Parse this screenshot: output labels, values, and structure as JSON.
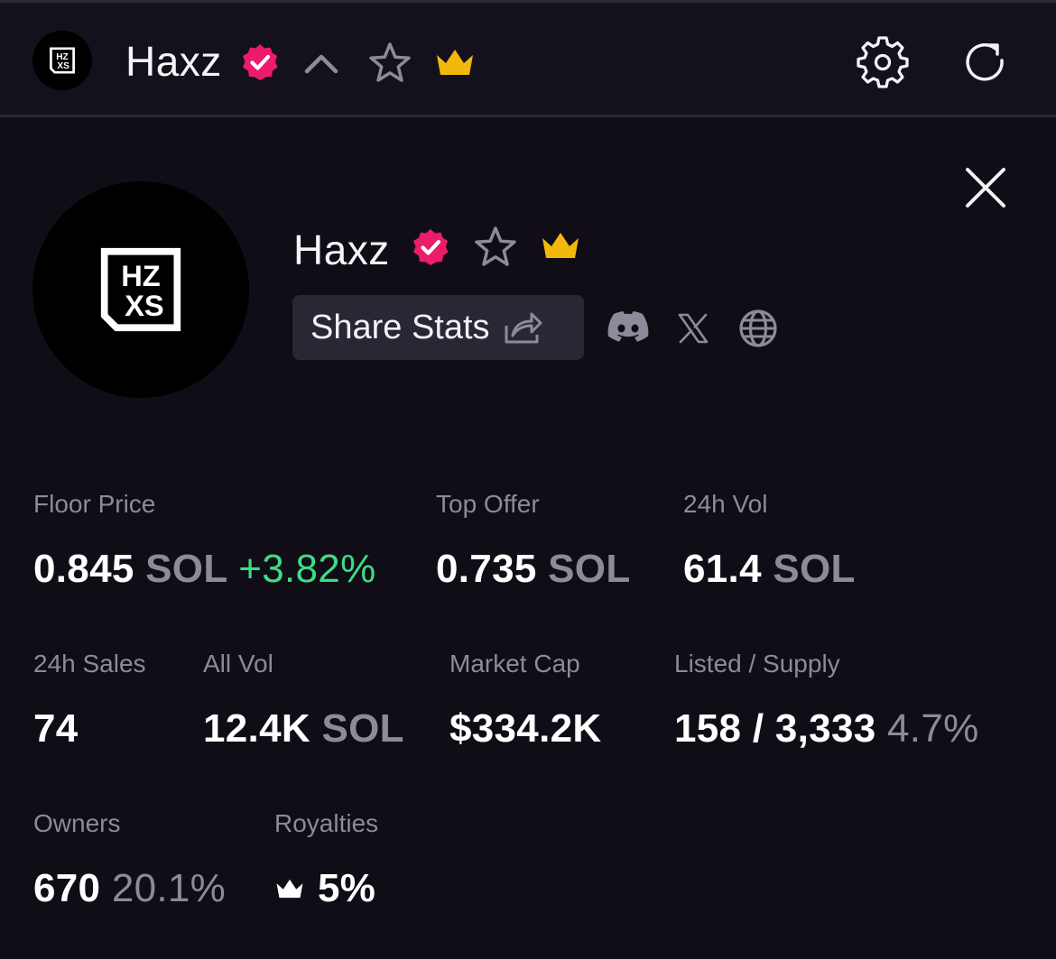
{
  "colors": {
    "background": "#100d17",
    "topbar_background": "#14111c",
    "verified_badge": "#ec1c6a",
    "crown_gold": "#f2b90c",
    "muted_text": "#8d8a99",
    "positive": "#3ddc84"
  },
  "header": {
    "collection_name": "Haxz",
    "logo_text_top": "HZ",
    "logo_text_bottom": "XS",
    "icons": [
      "verified-badge-icon",
      "chevron-up-icon",
      "star-icon",
      "crown-icon",
      "gear-icon",
      "refresh-icon"
    ]
  },
  "profile": {
    "name": "Haxz",
    "logo_text_top": "HZ",
    "logo_text_bottom": "XS",
    "share_label": "Share Stats",
    "socials": [
      "discord-icon",
      "x-icon",
      "globe-icon"
    ],
    "close_icon": "close-icon"
  },
  "stats": {
    "floor_price": {
      "label": "Floor Price",
      "value": "0.845",
      "unit": "SOL",
      "change": "+3.82%"
    },
    "top_offer": {
      "label": "Top Offer",
      "value": "0.735",
      "unit": "SOL"
    },
    "vol_24h": {
      "label": "24h Vol",
      "value": "61.4",
      "unit": "SOL"
    },
    "sales_24h": {
      "label": "24h Sales",
      "value": "74"
    },
    "all_vol": {
      "label": "All Vol",
      "value": "12.4K",
      "unit": "SOL"
    },
    "market_cap": {
      "label": "Market Cap",
      "value": "$334.2K"
    },
    "listed_supply": {
      "label": "Listed / Supply",
      "value": "158 / 3,333",
      "pct": "4.7%"
    },
    "owners": {
      "label": "Owners",
      "value": "670",
      "pct": "20.1%"
    },
    "royalties": {
      "label": "Royalties",
      "value": "5%"
    }
  }
}
